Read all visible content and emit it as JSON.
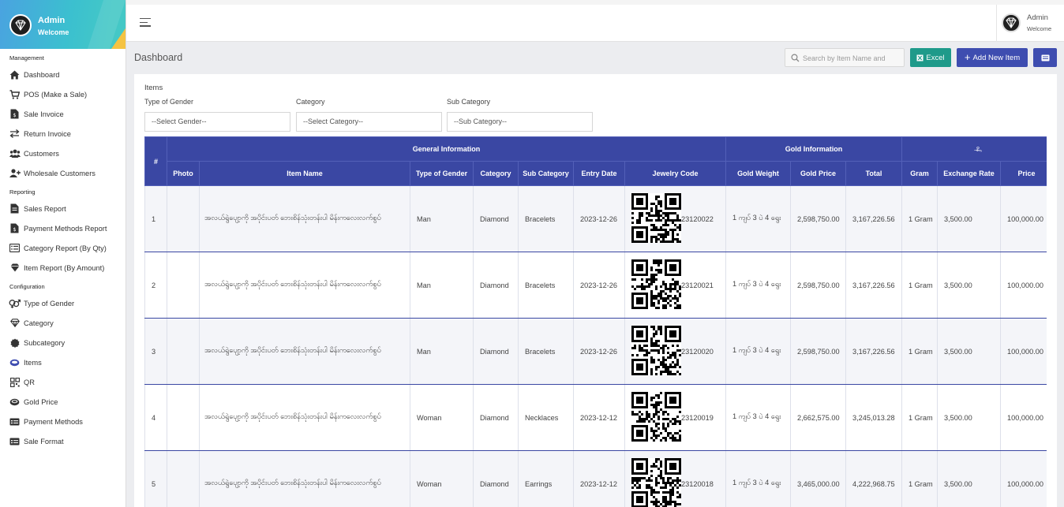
{
  "brand": {
    "name": "Admin",
    "subtitle": "Welcome"
  },
  "topbar": {
    "user_name": "Admin",
    "user_subtitle": "Welcome"
  },
  "sidebar": {
    "sections": [
      {
        "title": "Management",
        "items": [
          {
            "label": "Dashboard",
            "icon": "home-icon"
          },
          {
            "label": "POS (Make a Sale)",
            "icon": "cart-icon"
          },
          {
            "label": "Sale Invoice",
            "icon": "invoice-icon"
          },
          {
            "label": "Return Invoice",
            "icon": "swap-icon"
          },
          {
            "label": "Customers",
            "icon": "users-icon"
          },
          {
            "label": "Wholesale Customers",
            "icon": "user-plus-icon"
          }
        ]
      },
      {
        "title": "Reporting",
        "items": [
          {
            "label": "Sales Report",
            "icon": "report-icon"
          },
          {
            "label": "Payment Methods Report",
            "icon": "invoice-icon"
          },
          {
            "label": "Category Report (By Qty)",
            "icon": "list-icon"
          },
          {
            "label": "Item Report (By Amount)",
            "icon": "gem-icon"
          }
        ]
      },
      {
        "title": "Configuration",
        "items": [
          {
            "label": "Type of Gender",
            "icon": "gender-icon"
          },
          {
            "label": "Category",
            "icon": "gem-outline-icon"
          },
          {
            "label": "Subcategory",
            "icon": "gem-badge-icon"
          },
          {
            "label": "Items",
            "icon": "ring-icon",
            "active": true
          },
          {
            "label": "QR",
            "icon": "qr-icon"
          },
          {
            "label": "Gold Price",
            "icon": "coin-icon"
          },
          {
            "label": "Payment Methods",
            "icon": "card-icon"
          },
          {
            "label": "Sale Format",
            "icon": "card-icon"
          }
        ]
      }
    ]
  },
  "page": {
    "title": "Dashboard"
  },
  "search": {
    "placeholder": "Search by Item Name and"
  },
  "toolbar": {
    "excel_label": "Excel",
    "add_label": "Add New Item"
  },
  "card": {
    "title": "Items"
  },
  "filters": {
    "gender": {
      "label": "Type of Gender",
      "value": "--Select Gender--"
    },
    "category": {
      "label": "Category",
      "value": "--Select Category--"
    },
    "subcategory": {
      "label": "Sub Category",
      "value": "--Sub Category--"
    }
  },
  "table": {
    "group_headers": {
      "num": "#",
      "general": "General Information",
      "gold": "Gold Information",
      "extra": "ဝန်"
    },
    "columns": [
      "Photo",
      "Item Name",
      "Type of Gender",
      "Category",
      "Sub Category",
      "Entry Date",
      "Jewelry Code",
      "Gold Weight",
      "Gold Price",
      "Total",
      "Gram",
      "Exchange Rate",
      "Price"
    ],
    "rows": [
      {
        "num": "1",
        "name": "အလယ်ရွဲပျော့ကို အပိုင်းပတ် ဘေးစိန်သုံးတန်းပါ မိန်းကလေးလက်စွပ်",
        "gender": "Man",
        "category": "Diamond",
        "subcategory": "Bracelets",
        "date": "2023-12-26",
        "code": "23120022",
        "weight": "1 ကျပ် 3 ပဲ 4 ရွေး",
        "gold_price": "2,598,750.00",
        "total": "3,167,226.56",
        "gram": "1 Gram",
        "rate": "3,500.00",
        "price": "100,000.00"
      },
      {
        "num": "2",
        "name": "အလယ်ရွဲပျော့ကို အပိုင်းပတ် ဘေးစိန်သုံးတန်းပါ မိန်းကလေးလက်စွပ်",
        "gender": "Man",
        "category": "Diamond",
        "subcategory": "Bracelets",
        "date": "2023-12-26",
        "code": "23120021",
        "weight": "1 ကျပ် 3 ပဲ 4 ရွေး",
        "gold_price": "2,598,750.00",
        "total": "3,167,226.56",
        "gram": "1 Gram",
        "rate": "3,500.00",
        "price": "100,000.00"
      },
      {
        "num": "3",
        "name": "အလယ်ရွဲပျော့ကို အပိုင်းပတ် ဘေးစိန်သုံးတန်းပါ မိန်းကလေးလက်စွပ်",
        "gender": "Man",
        "category": "Diamond",
        "subcategory": "Bracelets",
        "date": "2023-12-26",
        "code": "23120020",
        "weight": "1 ကျပ် 3 ပဲ 4 ရွေး",
        "gold_price": "2,598,750.00",
        "total": "3,167,226.56",
        "gram": "1 Gram",
        "rate": "3,500.00",
        "price": "100,000.00"
      },
      {
        "num": "4",
        "name": "အလယ်ရွဲပျော့ကို အပိုင်းပတ် ဘေးစိန်သုံးတန်းပါ မိန်းကလေးလက်စွပ်",
        "gender": "Woman",
        "category": "Diamond",
        "subcategory": "Necklaces",
        "date": "2023-12-12",
        "code": "23120019",
        "weight": "1 ကျပ် 3 ပဲ 4 ရွေး",
        "gold_price": "2,662,575.00",
        "total": "3,245,013.28",
        "gram": "1 Gram",
        "rate": "3,500.00",
        "price": "100,000.00"
      },
      {
        "num": "5",
        "name": "အလယ်ရွဲပျော့ကို အပိုင်းပတ် ဘေးစိန်သုံးတန်းပါ မိန်းကလေးလက်စွပ်",
        "gender": "Woman",
        "category": "Diamond",
        "subcategory": "Earrings",
        "date": "2023-12-12",
        "code": "23120018",
        "weight": "1 ကျပ် 3 ပဲ 4 ရွေး",
        "gold_price": "3,465,000.00",
        "total": "4,222,968.75",
        "gram": "1 Gram",
        "rate": "3,500.00",
        "price": "100,000.00"
      }
    ]
  },
  "colors": {
    "primary": "#3e4db0",
    "table_header": "#3a47a3",
    "excel": "#1f9a8a",
    "brand_gradient_start": "#4aa3e0",
    "brand_gradient_end": "#44c8c6",
    "brand_accent": "#f5c342"
  }
}
